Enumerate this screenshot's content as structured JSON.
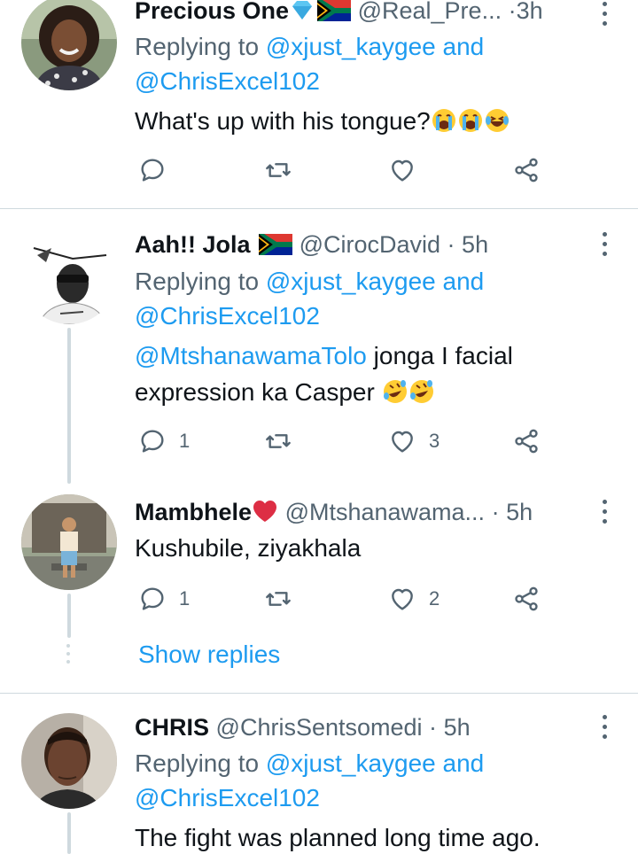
{
  "tweets": [
    {
      "name": "Precious One",
      "handle": "@Real_Pre...",
      "time": "3h",
      "replying_prefix": "Replying to",
      "reply_to_1": "@xjust_kaygee",
      "reply_and": "and",
      "reply_to_2": "@ChrisExcel102",
      "text": "What's up with his tongue?",
      "replies": "",
      "retweets": "",
      "likes": ""
    },
    {
      "name": "Aah!! Jola",
      "handle": "@CirocDavid",
      "time": "5h",
      "replying_prefix": "Replying to",
      "reply_to_1": "@xjust_kaygee",
      "reply_and": "and",
      "reply_to_2": "@ChrisExcel102",
      "mention": "@MtshanawamaTolo",
      "text_1": "jonga I facial",
      "text_2": "expression ka Casper",
      "replies": "1",
      "retweets": "",
      "likes": "3"
    },
    {
      "name": "Mambhele",
      "handle": "@Mtshanawama...",
      "time": "5h",
      "text": "Kushubile, ziyakhala",
      "replies": "1",
      "retweets": "",
      "likes": "2"
    },
    {
      "name": "CHRIS",
      "handle": "@ChrisSentsomedi",
      "time": "5h",
      "replying_prefix": "Replying to",
      "reply_to_1": "@xjust_kaygee",
      "reply_and": "and",
      "reply_to_2": "@ChrisExcel102",
      "text": "The fight was planned long time ago."
    }
  ],
  "show_replies": "Show replies",
  "separator": "·",
  "icons": [
    "reply-icon",
    "retweet-icon",
    "like-icon",
    "share-icon",
    "more-icon",
    "flag-icon",
    "gem-icon",
    "heart-emoji-icon",
    "crying-emoji-icon",
    "laughing-emoji-icon",
    "rofl-emoji-icon"
  ],
  "colors": {
    "link": "#1d9bf0",
    "secondary": "#536471",
    "divider": "#cfd9de",
    "text": "#0f1419"
  }
}
